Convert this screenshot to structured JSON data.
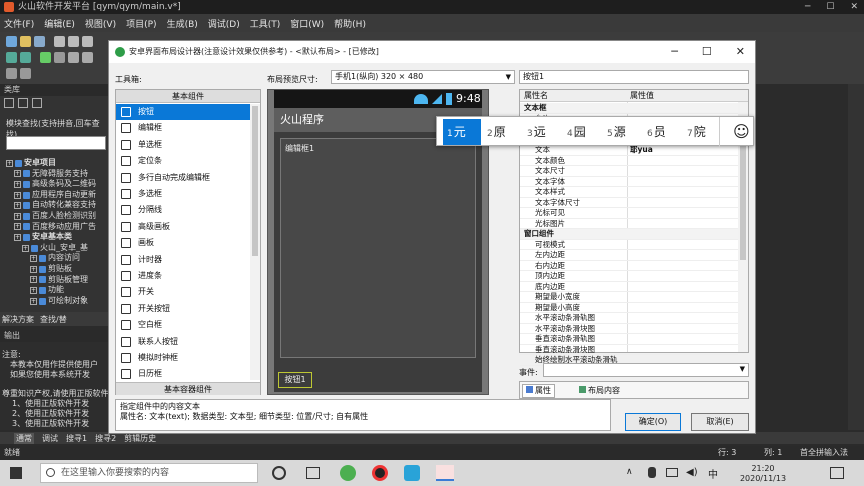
{
  "ide": {
    "title": "火山软件开发平台 [qym/qym/main.v*]",
    "menu": [
      "文件(F)",
      "编辑(E)",
      "视图(V)",
      "项目(P)",
      "生成(B)",
      "调试(D)",
      "工具(T)",
      "窗口(W)",
      "帮助(H)"
    ],
    "left_panel": {
      "header": "类库",
      "search_text": "模块查找(支持拼音,回车查找)",
      "tree": [
        {
          "level": 0,
          "label": "安卓项目",
          "bold": true
        },
        {
          "level": 1,
          "label": "无障碍服务支持"
        },
        {
          "level": 1,
          "label": "高级条码及二维码"
        },
        {
          "level": 1,
          "label": "应用程序自动更新"
        },
        {
          "level": 1,
          "label": "自动转化兼容支持"
        },
        {
          "level": 1,
          "label": "百度人脸检测识别"
        },
        {
          "level": 1,
          "label": "百度移动应用广告"
        },
        {
          "level": 1,
          "label": "安卓基本类",
          "bold": true
        },
        {
          "level": 2,
          "label": "火山_安卓_基"
        },
        {
          "level": 3,
          "label": "内容访问"
        },
        {
          "level": 3,
          "label": "剪贴板"
        },
        {
          "level": 3,
          "label": "剪贴板管理"
        },
        {
          "level": 3,
          "label": "功能"
        },
        {
          "level": 3,
          "label": "可绘制对象"
        }
      ],
      "tabs": [
        "解决方案",
        "查找/替"
      ]
    },
    "output": {
      "header": "输出",
      "lines": [
        "注意:",
        "本教本仅用作提供使用户",
        "如果您使用本系统开发",
        "",
        "尊重知识产权,请使用正版软件",
        "1、使用正版软件开发",
        "2、使用正版软件开发",
        "3、使用正版软件开发"
      ]
    },
    "output_tabs": [
      "通常",
      "调试",
      "搜寻1",
      "搜寻2",
      "剪辑历史"
    ],
    "status": {
      "ready": "就绪",
      "row": "行: 3",
      "col": "列: 1",
      "ime": "首全拼输入法"
    }
  },
  "dialog": {
    "title": "安卓界面布局设计器(注意设计效果仅供参考) - <默认布局> - [已修改]",
    "toolbox_label": "工具箱:",
    "palette_header": "基本组件",
    "palette_footer": "基本容器组件",
    "palette_items": [
      "按钮",
      "编辑框",
      "单选框",
      "定位条",
      "多行自动完成编辑框",
      "多选框",
      "分隔线",
      "高级画板",
      "画板",
      "计时器",
      "进度条",
      "开关",
      "开关按钮",
      "空白框",
      "联系人按钮",
      "模拟时钟框",
      "日历框"
    ],
    "preview_label": "布局预览尺寸:",
    "preview_size": "手机1(纵向) 320 × 480",
    "phone": {
      "time": "9:48",
      "app_title": "火山程序",
      "edit_text": "编辑框1",
      "button_text": "按钮1"
    },
    "component_name": "按钮1",
    "props_header": {
      "name": "属性名",
      "value": "属性值"
    },
    "props": [
      {
        "group": true,
        "name": "文本框"
      },
      {
        "name": "允许",
        "value": ""
      },
      {
        "name": "内容横向对齐",
        "value": "居中"
      },
      {
        "name": "内容纵向对齐",
        "value": "居中"
      },
      {
        "name": "文本",
        "value": "耶yua"
      },
      {
        "name": "文本颜色",
        "value": ""
      },
      {
        "name": "文本尺寸",
        "value": ""
      },
      {
        "name": "文本字体",
        "value": ""
      },
      {
        "name": "文本样式",
        "value": ""
      },
      {
        "name": "文本字体尺寸",
        "value": ""
      },
      {
        "name": "光标可见",
        "value": ""
      },
      {
        "name": "光标图片",
        "value": ""
      },
      {
        "group": true,
        "name": "窗口组件"
      },
      {
        "name": "可视模式",
        "value": ""
      },
      {
        "name": "左内边距",
        "value": ""
      },
      {
        "name": "右内边距",
        "value": ""
      },
      {
        "name": "顶内边距",
        "value": ""
      },
      {
        "name": "底内边距",
        "value": ""
      },
      {
        "name": "期望最小宽度",
        "value": ""
      },
      {
        "name": "期望最小高度",
        "value": ""
      },
      {
        "name": "水平滚动条滑轨图",
        "value": ""
      },
      {
        "name": "水平滚动条滑块图",
        "value": ""
      },
      {
        "name": "垂直滚动条滑轨图",
        "value": ""
      },
      {
        "name": "垂直滚动条滑块图",
        "value": ""
      },
      {
        "name": "始终绘制水平滚动条滑轨",
        "value": ""
      }
    ],
    "ime": {
      "candidates": [
        {
          "n": "1",
          "t": "元"
        },
        {
          "n": "2",
          "t": "原"
        },
        {
          "n": "3",
          "t": "远"
        },
        {
          "n": "4",
          "t": "园"
        },
        {
          "n": "5",
          "t": "源"
        },
        {
          "n": "6",
          "t": "员"
        },
        {
          "n": "7",
          "t": "院"
        }
      ],
      "emoji": "☺"
    },
    "event_label": "事件:",
    "tabs": [
      "属性",
      "布局内容"
    ],
    "hint_lines": [
      "指定组件中的内容文本",
      "属性名: 文本(text); 数据类型: 文本型; 细节类型: 位置/尺寸; 自有属性"
    ],
    "ok": "确定(O)",
    "cancel": "取消(E)"
  },
  "taskbar": {
    "search_placeholder": "在这里输入你要搜索的内容",
    "time": "21:20",
    "date": "2020/11/13",
    "ime": "中"
  }
}
